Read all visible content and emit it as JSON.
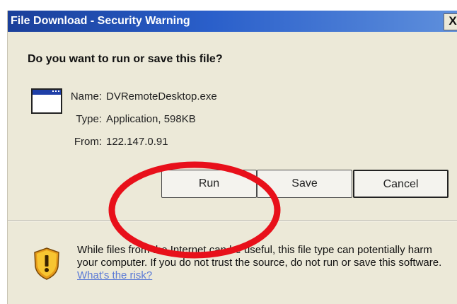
{
  "window": {
    "title": "File Download - Security Warning",
    "close_glyph": "X"
  },
  "question": "Do you want to run or save this file?",
  "file": {
    "icon": "application-window-icon",
    "name_label": "Name:",
    "name_value": "DVRemoteDesktop.exe",
    "type_label": "Type:",
    "type_value": "Application, 598KB",
    "from_label": "From:",
    "from_value": "122.147.0.91"
  },
  "buttons": {
    "run": "Run",
    "save": "Save",
    "cancel": "Cancel"
  },
  "warning": {
    "icon": "security-shield-icon",
    "text": "While files from the Internet can be useful, this file type can potentially harm your computer. If you do not trust the source, do not run or save this software. ",
    "link": "What's the risk?"
  },
  "annotation": {
    "shape": "ellipse",
    "color": "#e8101a"
  },
  "colors": {
    "titlebar": "#2a5fca",
    "dialog_bg": "#ece9d8",
    "link": "#5b7ad6"
  }
}
